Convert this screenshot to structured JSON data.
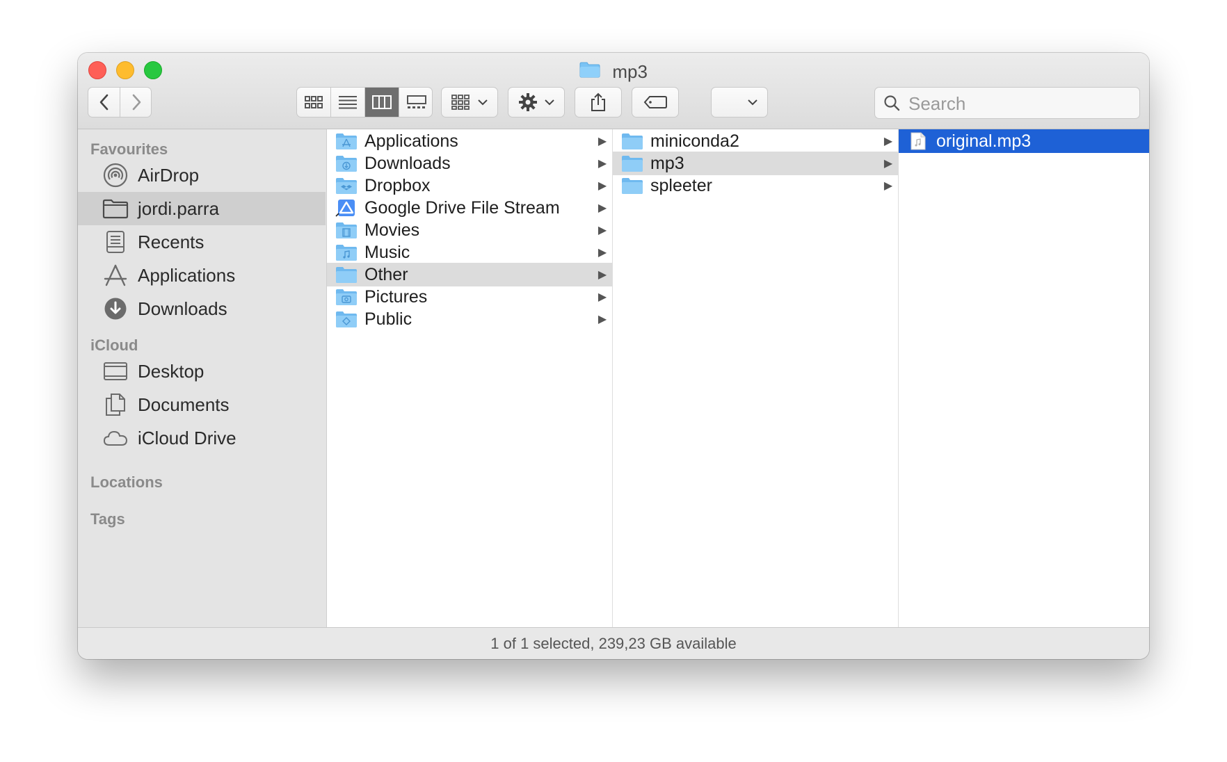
{
  "window": {
    "title": "mp3"
  },
  "toolbar": {
    "back_icon": "chevron-left-icon",
    "forward_icon": "chevron-right-icon",
    "view_modes": [
      "icon-view",
      "list-view",
      "column-view",
      "gallery-view"
    ],
    "active_view": "column-view",
    "search": {
      "placeholder": "Search",
      "value": ""
    }
  },
  "sidebar": {
    "sections": [
      {
        "header": "Favourites",
        "items": [
          {
            "label": "AirDrop",
            "icon": "airdrop-icon"
          },
          {
            "label": "jordi.parra",
            "icon": "home-folder-icon",
            "selected": true
          },
          {
            "label": "Recents",
            "icon": "recents-icon"
          },
          {
            "label": "Applications",
            "icon": "applications-icon"
          },
          {
            "label": "Downloads",
            "icon": "downloads-icon"
          }
        ]
      },
      {
        "header": "iCloud",
        "items": [
          {
            "label": "Desktop",
            "icon": "desktop-icon"
          },
          {
            "label": "Documents",
            "icon": "documents-icon"
          },
          {
            "label": "iCloud Drive",
            "icon": "cloud-icon"
          }
        ]
      },
      {
        "header": "Locations",
        "items": []
      },
      {
        "header": "Tags",
        "items": []
      }
    ]
  },
  "columns": [
    {
      "items": [
        {
          "label": "Applications",
          "selected": false
        },
        {
          "label": "Downloads",
          "selected": false
        },
        {
          "label": "Dropbox",
          "selected": false
        },
        {
          "label": "Google Drive File Stream",
          "selected": false
        },
        {
          "label": "Movies",
          "selected": false
        },
        {
          "label": "Music",
          "selected": false
        },
        {
          "label": "Other",
          "selected": true
        },
        {
          "label": "Pictures",
          "selected": false
        },
        {
          "label": "Public",
          "selected": false
        }
      ]
    },
    {
      "items": [
        {
          "label": "miniconda2",
          "selected": false
        },
        {
          "label": "mp3",
          "selected": true
        },
        {
          "label": "spleeter",
          "selected": false
        }
      ]
    },
    {
      "items": [
        {
          "label": "original.mp3",
          "selected": true
        }
      ]
    }
  ],
  "status": {
    "text": "1 of 1 selected, 239,23 GB available"
  },
  "colors": {
    "selection_blue": "#1e61d6",
    "folder_blue": "#7ac3f5",
    "sidebar_bg": "#e4e4e4"
  }
}
